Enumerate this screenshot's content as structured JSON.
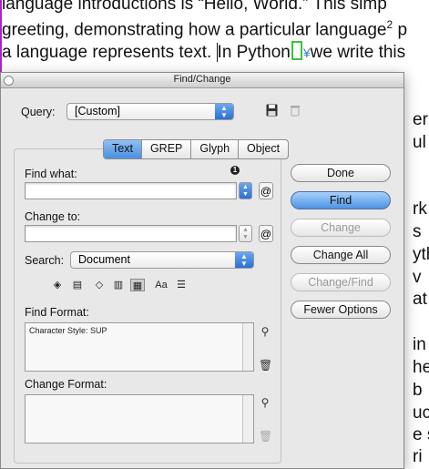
{
  "document": {
    "line1": "language introductions is “Hello, World.” This simp",
    "line2_a": "greeting, demonstrating how a particular language",
    "line2_sup": "2",
    "line2_b": " p",
    "line3_a": "a language represents text. ",
    "line3_b": "In Python",
    "line3_anchor": "¥",
    "line3_c": "we write this",
    "right_fragments": [
      "erp",
      "ul",
      "rk",
      "s",
      "yth",
      "v",
      "at",
      "in",
      "he",
      "b",
      "uc",
      "e s",
      "ri"
    ]
  },
  "dialog": {
    "title": "Find/Change",
    "query_label": "Query:",
    "query_value": "[Custom]",
    "tabs": [
      {
        "label": "Text",
        "active": true
      },
      {
        "label": "GREP",
        "active": false
      },
      {
        "label": "Glyph",
        "active": false
      },
      {
        "label": "Object",
        "active": false
      }
    ],
    "find_what_label": "Find what:",
    "find_what_value": "",
    "change_to_label": "Change to:",
    "change_to_value": "",
    "search_label": "Search:",
    "search_value": "Document",
    "find_format_label": "Find Format:",
    "find_format_value": "Character Style: SUP",
    "change_format_label": "Change Format:",
    "change_format_value": "",
    "info_badge": "1",
    "buttons": {
      "done": "Done",
      "find": "Find",
      "change": "Change",
      "change_all": "Change All",
      "change_find": "Change/Find",
      "fewer_options": "Fewer Options"
    },
    "option_icons": [
      "include-locked-layers-icon",
      "include-locked-stories-icon",
      "include-hidden-layers-icon",
      "include-master-pages-icon",
      "include-footnotes-icon",
      "case-sensitive-icon",
      "whole-word-icon"
    ],
    "case_sensitive_text": "Aa"
  },
  "colors": {
    "accent": "#4a8fe0",
    "dialog_bg": "#e8e8e8",
    "cursor_frame": "#3cc23c",
    "margin_guide": "#b020d0"
  }
}
